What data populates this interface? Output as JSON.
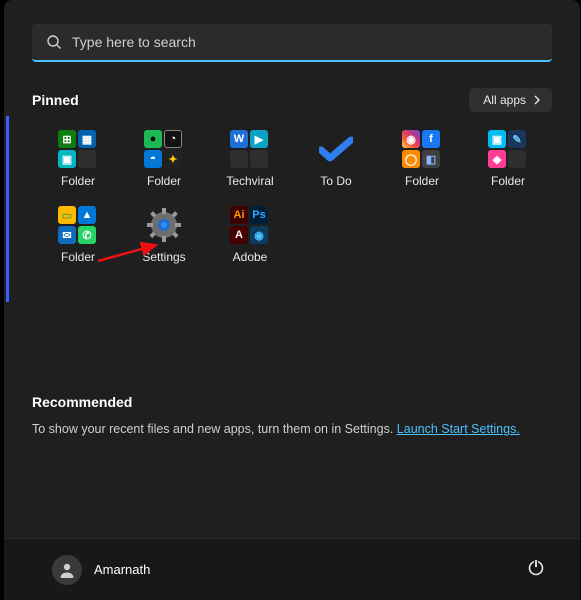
{
  "search": {
    "placeholder": "Type here to search"
  },
  "pinned": {
    "title": "Pinned",
    "all_apps_label": "All apps",
    "items": [
      {
        "label": "Folder"
      },
      {
        "label": "Folder"
      },
      {
        "label": "Techviral"
      },
      {
        "label": "To Do"
      },
      {
        "label": "Folder"
      },
      {
        "label": "Folder"
      },
      {
        "label": "Folder"
      },
      {
        "label": "Settings"
      },
      {
        "label": "Adobe"
      }
    ]
  },
  "recommended": {
    "title": "Recommended",
    "text": "To show your recent files and new apps, turn them on in Settings. ",
    "link": "Launch Start Settings."
  },
  "user": {
    "name": "Amarnath"
  },
  "colors": {
    "xbox": "#107c10",
    "calendar": "#0063b1",
    "photos": "#00b7c3",
    "spotify": "#1db954",
    "clock": "#ffffff",
    "bulb": "#0078d7",
    "word": "#2b579a",
    "video": "#00b7c3",
    "instagram": "#c13584",
    "facebook": "#1877f2",
    "browser": "#ff8c00",
    "theme": "#404040",
    "paint": "#00bcf2",
    "pink": "#ff3e96",
    "explorer": "#ffb900",
    "pictures": "#0078d7",
    "mail": "#0f6cbd",
    "whatsapp": "#25d366",
    "ai": "#3c0000",
    "ps": "#001e36",
    "edge": "#0c59a4",
    "blank": "#2e2e2e"
  }
}
